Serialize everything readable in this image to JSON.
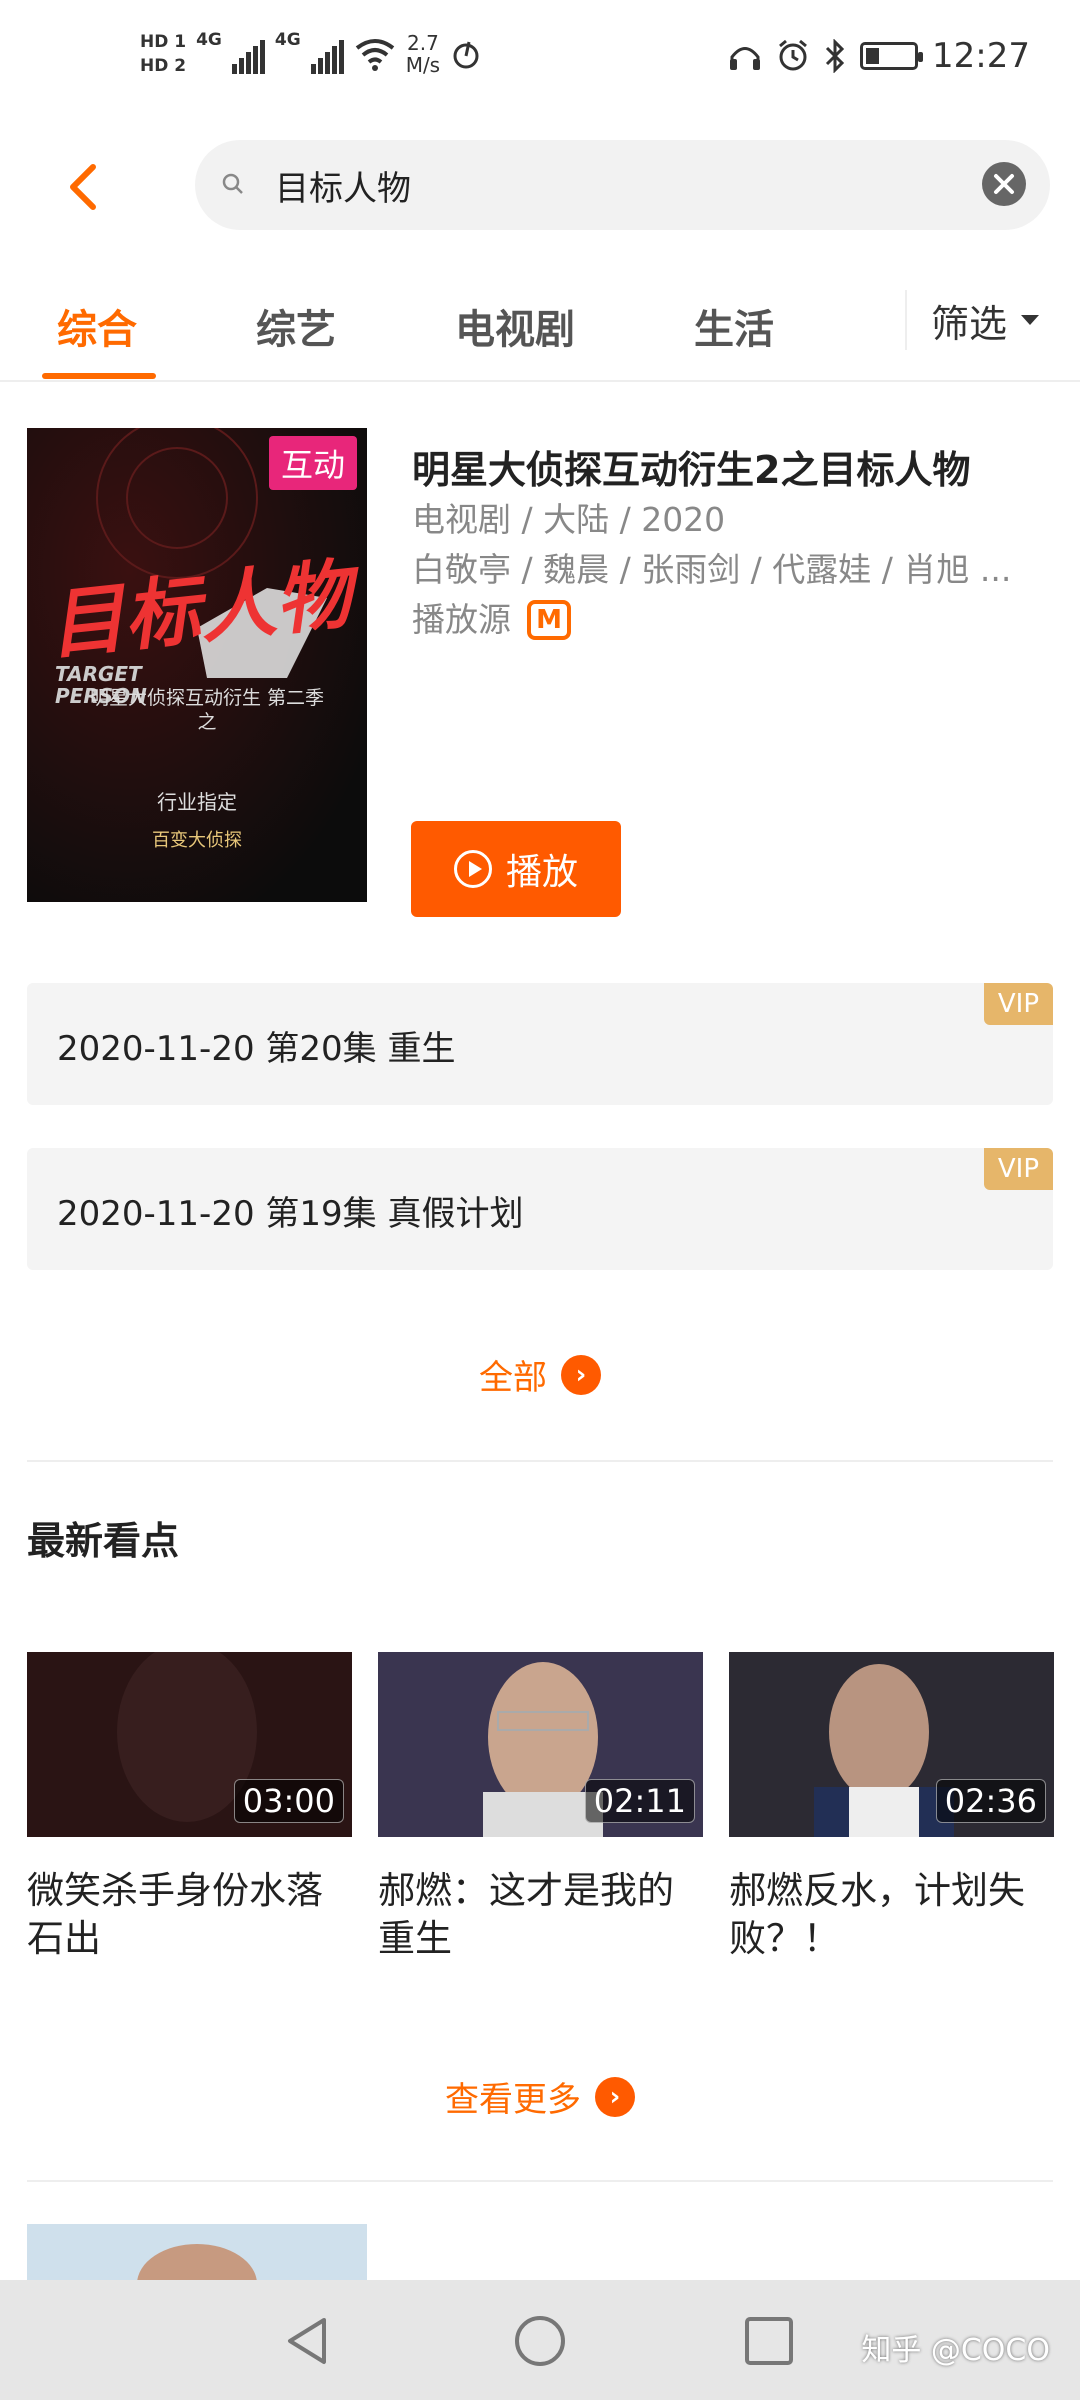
{
  "status_bar": {
    "hd1": "HD 1",
    "hd2": "HD 2",
    "net1": "4G",
    "net2": "4G",
    "speed_value": "2.7",
    "speed_unit": "M/s",
    "time": "12:27",
    "battery_fraction": 0.28
  },
  "search": {
    "query": "目标人物",
    "back_icon": "chevron-left-icon",
    "clear_icon": "clear-icon"
  },
  "tabs": [
    {
      "label": "综合",
      "active": true
    },
    {
      "label": "综艺",
      "active": false
    },
    {
      "label": "电视剧",
      "active": false
    },
    {
      "label": "生活",
      "active": false
    }
  ],
  "filter": {
    "label": "筛选"
  },
  "show": {
    "badge": "互动",
    "poster_title": "目标人物",
    "poster_en_1": "TARGET",
    "poster_en_2": "PERSON",
    "poster_sub": "明星大侦探互动衍生 第二季之",
    "poster_rec": "行业指定",
    "poster_logo": "百变大侦探",
    "title": "明星大侦探互动衍生2之目标人物",
    "meta": "电视剧 / 大陆 / 2020",
    "cast": "白敬亭 / 魏晨 / 张雨剑 / 代露娃 / 肖旭 ...",
    "source_label": "播放源",
    "source_icon": "mgtv-logo-icon",
    "play_label": "播放"
  },
  "episodes": [
    {
      "text": "2020-11-20 第20集 重生",
      "badge": "VIP"
    },
    {
      "text": "2020-11-20 第19集 真假计划",
      "badge": "VIP"
    }
  ],
  "all_label": "全部",
  "section_title": "最新看点",
  "videos": [
    {
      "title": "微笑杀手身份水落石出",
      "duration": "03:00",
      "thumb_color": "#2a1414"
    },
    {
      "title": "郝燃：这才是我的重生",
      "duration": "02:11",
      "thumb_color": "#3a3550"
    },
    {
      "title": "郝燃反水，计划失败？！",
      "duration": "02:36",
      "thumb_color": "#2c2a33"
    }
  ],
  "more_label": "查看更多",
  "watermark": "知乎 @COCO",
  "colors": {
    "accent": "#ff6a00",
    "vip": "#e6b66a",
    "badge": "#e8267a"
  }
}
